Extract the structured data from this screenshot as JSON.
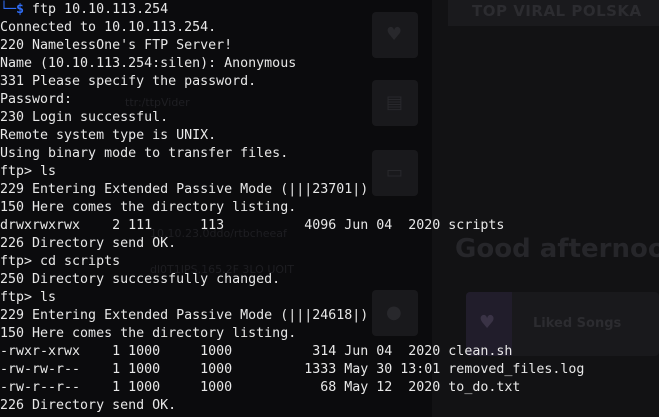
{
  "background_app": {
    "banner": "TOP VIRAL POLSKA",
    "greeting": "Good afternoon",
    "card_label": "Liked Songs",
    "faint_lines": [
      "ttr:/ttpVider",
      "10.10.23.0ddo/rtbcheeaf",
      "dl0T1IPS.165.2F 3LO UOIT"
    ]
  },
  "terminal": {
    "prompt_symbol": "$",
    "command": "ftp 10.10.113.254",
    "lines": [
      "Connected to 10.10.113.254.",
      "220 NamelessOne's FTP Server!",
      "Name (10.10.113.254:silen): Anonymous",
      "331 Please specify the password.",
      "Password:",
      "230 Login successful.",
      "Remote system type is UNIX.",
      "Using binary mode to transfer files.",
      "ftp> ls",
      "229 Entering Extended Passive Mode (|||23701|)",
      "150 Here comes the directory listing.",
      "drwxrwxrwx    2 111      113          4096 Jun 04  2020 scripts",
      "226 Directory send OK.",
      "ftp> cd scripts",
      "250 Directory successfully changed.",
      "ftp> ls",
      "229 Entering Extended Passive Mode (|||24618|)",
      "150 Here comes the directory listing.",
      "-rwxr-xrwx    1 1000     1000          314 Jun 04  2020 clean.sh",
      "-rw-rw-r--    1 1000     1000         1333 May 30 13:01 removed_files.log",
      "-rw-r--r--    1 1000     1000           68 May 12  2020 to_do.txt",
      "226 Directory send OK."
    ]
  }
}
